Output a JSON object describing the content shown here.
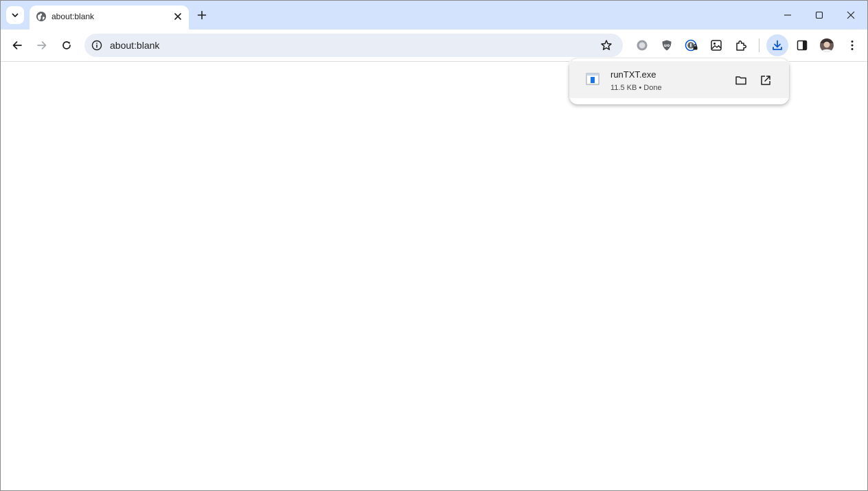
{
  "tab": {
    "title": "about:blank",
    "favicon": "globe-icon",
    "close_icon": "close-icon"
  },
  "tabstrip": {
    "tab_search_icon": "chevron-down-icon",
    "new_tab_icon": "plus-icon"
  },
  "window_controls": {
    "minimize_icon": "minimize-icon",
    "maximize_icon": "maximize-icon",
    "close_icon": "close-icon"
  },
  "toolbar": {
    "back_icon": "arrow-left-icon",
    "forward_icon": "arrow-right-icon",
    "reload_icon": "reload-icon",
    "extensions": [
      "circle-extension-icon",
      "ublock-shield-icon",
      "password-manager-icon",
      "image-extension-icon",
      "puzzle-icon"
    ],
    "downloads_icon": "download-icon",
    "side_panel_icon": "side-panel-icon",
    "profile_icon": "avatar",
    "menu_icon": "kebab-menu-icon"
  },
  "omnibox": {
    "url": "about:blank",
    "info_icon": "info-icon",
    "bookmark_icon": "star-icon"
  },
  "downloads": {
    "items": [
      {
        "filename": "runTXT.exe",
        "status": "11.5 KB • Done",
        "file_icon": "exe-file-icon",
        "show_in_folder_icon": "folder-icon",
        "open_icon": "open-external-icon"
      }
    ]
  },
  "colors": {
    "tabstrip_bg": "#d3e3fd",
    "omnibox_bg": "#e9eef6",
    "accent": "#0b57d0"
  }
}
